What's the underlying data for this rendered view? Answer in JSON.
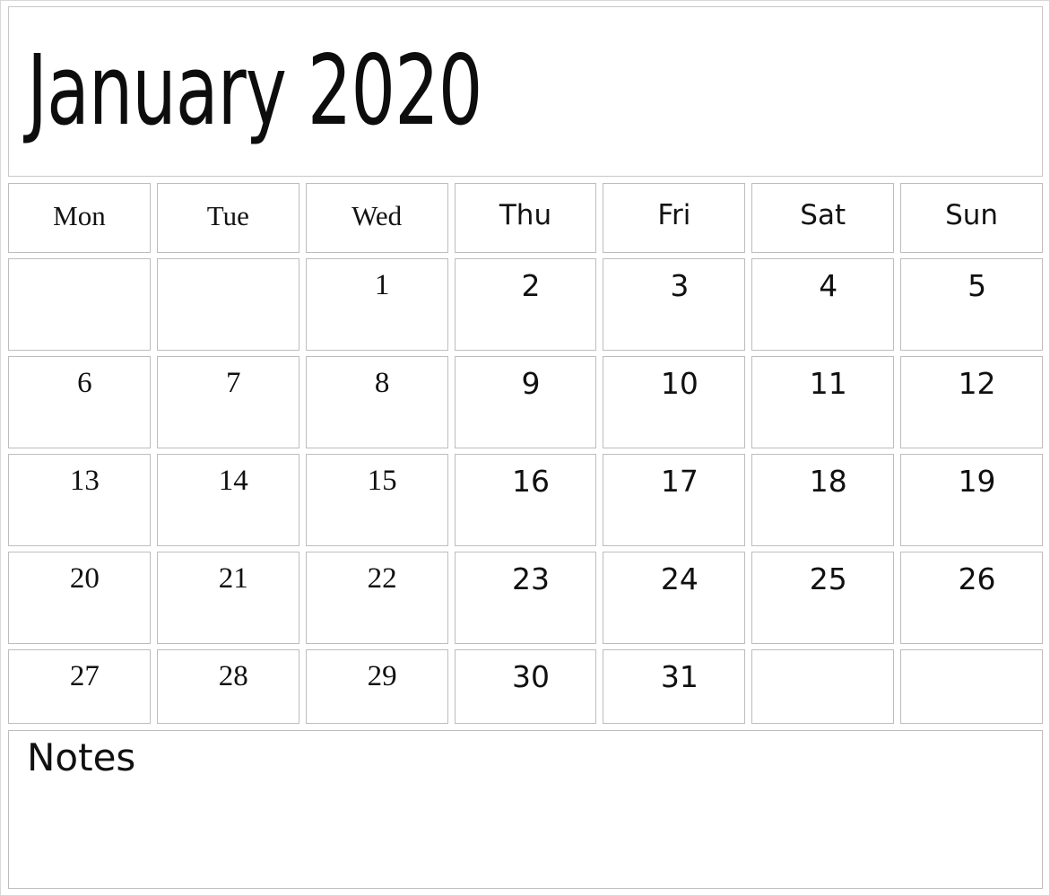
{
  "document": {
    "type": "monthly-calendar",
    "title": "January 2020",
    "month": "January",
    "year": "2020",
    "week_start": "Monday"
  },
  "weekdays": [
    {
      "label": "Mon",
      "font": "serif"
    },
    {
      "label": "Tue",
      "font": "serif"
    },
    {
      "label": "Wed",
      "font": "serif"
    },
    {
      "label": "Thu",
      "font": "sans"
    },
    {
      "label": "Fri",
      "font": "sans"
    },
    {
      "label": "Sat",
      "font": "sans"
    },
    {
      "label": "Sun",
      "font": "sans"
    }
  ],
  "weeks": [
    [
      {
        "date": "",
        "empty": true
      },
      {
        "date": "",
        "empty": true
      },
      {
        "date": "1",
        "empty": false
      },
      {
        "date": "2",
        "empty": false
      },
      {
        "date": "3",
        "empty": false
      },
      {
        "date": "4",
        "empty": false
      },
      {
        "date": "5",
        "empty": false
      }
    ],
    [
      {
        "date": "6",
        "empty": false
      },
      {
        "date": "7",
        "empty": false
      },
      {
        "date": "8",
        "empty": false
      },
      {
        "date": "9",
        "empty": false
      },
      {
        "date": "10",
        "empty": false
      },
      {
        "date": "11",
        "empty": false
      },
      {
        "date": "12",
        "empty": false
      }
    ],
    [
      {
        "date": "13",
        "empty": false
      },
      {
        "date": "14",
        "empty": false
      },
      {
        "date": "15",
        "empty": false
      },
      {
        "date": "16",
        "empty": false
      },
      {
        "date": "17",
        "empty": false
      },
      {
        "date": "18",
        "empty": false
      },
      {
        "date": "19",
        "empty": false
      }
    ],
    [
      {
        "date": "20",
        "empty": false
      },
      {
        "date": "21",
        "empty": false
      },
      {
        "date": "22",
        "empty": false
      },
      {
        "date": "23",
        "empty": false
      },
      {
        "date": "24",
        "empty": false
      },
      {
        "date": "25",
        "empty": false
      },
      {
        "date": "26",
        "empty": false
      }
    ],
    [
      {
        "date": "27",
        "empty": false
      },
      {
        "date": "28",
        "empty": false
      },
      {
        "date": "29",
        "empty": false
      },
      {
        "date": "30",
        "empty": false
      },
      {
        "date": "31",
        "empty": false
      },
      {
        "date": "",
        "empty": true
      },
      {
        "date": "",
        "empty": true
      }
    ]
  ],
  "notes": {
    "label": "Notes",
    "content": ""
  },
  "colors": {
    "text": "#101010",
    "cell_border": "#bdbdbd",
    "page_border": "#d8d8d8",
    "background": "#ffffff"
  }
}
